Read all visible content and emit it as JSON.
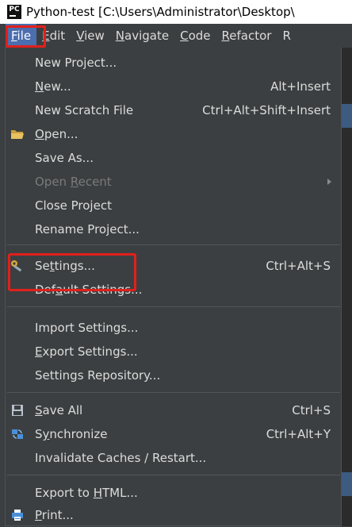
{
  "window": {
    "app_icon_text": "PC",
    "title": "Python-test [C:\\Users\\Administrator\\Desktop\\"
  },
  "menubar": {
    "items": [
      {
        "label": "File",
        "mnemonic": "F",
        "rest": "ile",
        "active": true
      },
      {
        "label": "Edit",
        "mnemonic": "E",
        "rest": "dit"
      },
      {
        "label": "View",
        "mnemonic": "V",
        "rest": "iew"
      },
      {
        "label": "Navigate",
        "mnemonic": "N",
        "rest": "avigate"
      },
      {
        "label": "Code",
        "mnemonic": "C",
        "rest": "ode"
      },
      {
        "label": "Refactor",
        "mnemonic": "R",
        "rest": "efactor"
      },
      {
        "label": "R",
        "mnemonic": "R",
        "rest": ""
      }
    ]
  },
  "file_menu": {
    "new_project": {
      "label": "New Project..."
    },
    "new": {
      "pre": "",
      "mn": "N",
      "post": "ew...",
      "shortcut": "Alt+Insert"
    },
    "new_scratch": {
      "label": "New Scratch File",
      "shortcut": "Ctrl+Alt+Shift+Insert"
    },
    "open": {
      "pre": "",
      "mn": "O",
      "post": "pen...",
      "icon": "folder-icon"
    },
    "save_as": {
      "label": "Save As..."
    },
    "open_recent": {
      "pre": "Open ",
      "mn": "R",
      "post": "ecent",
      "disabled": true
    },
    "close_project": {
      "label": "Close Project"
    },
    "rename_project": {
      "label": "Rename Project..."
    },
    "settings": {
      "pre": "Se",
      "mn": "t",
      "post": "tings...",
      "shortcut": "Ctrl+Alt+S",
      "icon": "wrench-icon"
    },
    "default_settings": {
      "pre": "Def",
      "mn": "a",
      "post": "ult Settings..."
    },
    "import_settings": {
      "label": "Import Settings..."
    },
    "export_settings": {
      "pre": "",
      "mn": "E",
      "post": "xport Settings..."
    },
    "settings_repository": {
      "label": "Settings Repository..."
    },
    "save_all": {
      "pre": "",
      "mn": "S",
      "post": "ave All",
      "shortcut": "Ctrl+S",
      "icon": "save-all-icon"
    },
    "synchronize": {
      "pre": "S",
      "mn": "y",
      "post": "nchronize",
      "shortcut": "Ctrl+Alt+Y",
      "icon": "sync-icon"
    },
    "invalidate_caches": {
      "label": "Invalidate Caches / Restart..."
    },
    "export_html": {
      "pre": "Export to ",
      "mn": "H",
      "post": "TML..."
    },
    "print": {
      "pre": "",
      "mn": "P",
      "post": "rint...",
      "icon": "print-icon"
    }
  },
  "colors": {
    "menu_bg": "#3c3f41",
    "active_menu": "#4b6eaf",
    "highlight_box": "#e0201c",
    "text": "#dcdcdc",
    "disabled_text": "#7a7a7a"
  }
}
